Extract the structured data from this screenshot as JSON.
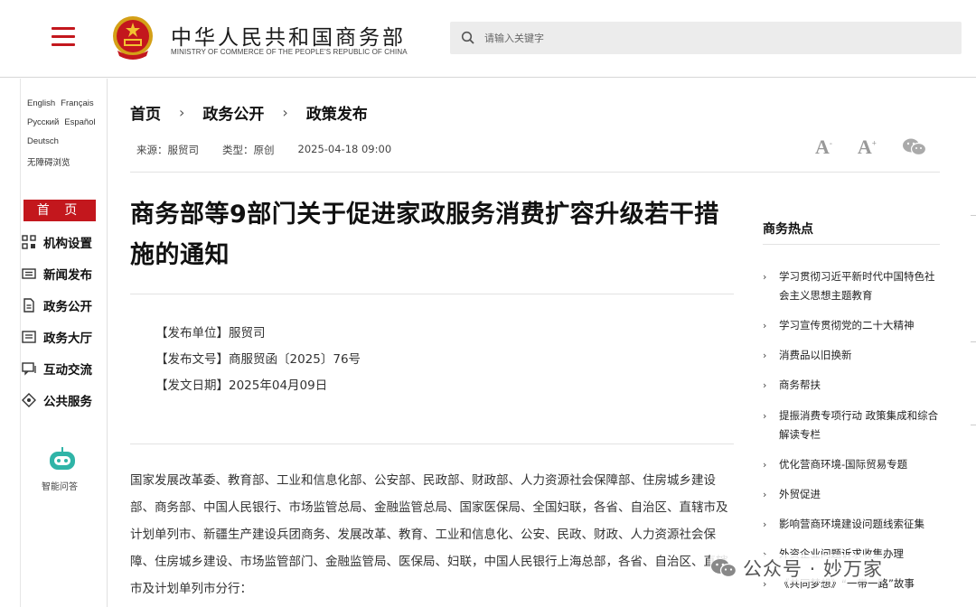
{
  "header": {
    "title": "中华人民共和国商务部",
    "subtitle": "MINISTRY OF COMMERCE OF THE PEOPLE'S REPUBLIC OF CHINA",
    "search_placeholder": "请输入关键字"
  },
  "sidebar": {
    "languages": [
      [
        "English",
        "Français"
      ],
      [
        "Русский",
        "Español"
      ],
      [
        "Deutsch"
      ],
      [
        "无障碍浏览"
      ]
    ],
    "home_label": "首 页",
    "nav_items": [
      {
        "label": "机构设置",
        "icon": "grid-icon"
      },
      {
        "label": "新闻发布",
        "icon": "news-icon"
      },
      {
        "label": "政务公开",
        "icon": "document-icon"
      },
      {
        "label": "政务大厅",
        "icon": "list-icon"
      },
      {
        "label": "互动交流",
        "icon": "chat-icon"
      },
      {
        "label": "公共服务",
        "icon": "service-icon"
      }
    ],
    "assistant_label": "智能问答"
  },
  "breadcrumb": [
    "首页",
    "政务公开",
    "政策发布"
  ],
  "meta": {
    "source": "来源：服贸司",
    "type": "类型：原创",
    "date": "2025-04-18 09:00"
  },
  "tools": {
    "font_small": "A",
    "font_large": "A"
  },
  "article": {
    "title": "商务部等9部门关于促进家政服务消费扩容升级若干措施的通知",
    "issuer": "【发布单位】服贸司",
    "doc_number": "【发布文号】商服贸函〔2025〕76号",
    "issue_date": "【发文日期】2025年04月09日",
    "body": "国家发展改革委、教育部、工业和信息化部、公安部、民政部、财政部、人力资源社会保障部、住房城乡建设部、商务部、中国人民银行、市场监管总局、金融监管总局、国家医保局、全国妇联，各省、自治区、直辖市及计划单列市、新疆生产建设兵团商务、发展改革、教育、工业和信息化、公安、民政、财政、人力资源社会保障、住房城乡建设、市场监管部门、金融监管局、医保局、妇联，中国人民银行上海总部，各省、自治区、直辖市及计划单列市分行："
  },
  "hot": {
    "title": "商务热点",
    "items": [
      "学习贯彻习近平新时代中国特色社会主义思想主题教育",
      "学习宣传贯彻党的二十大精神",
      "消费品以旧换新",
      "商务帮扶",
      "提振消费专项行动 政策集成和综合解读专栏",
      "优化营商环境-国际贸易专题",
      "外贸促进",
      "影响营商环境建设问题线索征集",
      "外资企业问题诉求收集办理",
      "《共同梦想》“一带一路”故事"
    ]
  },
  "watermark": {
    "text": "公众号 · 妙万家"
  },
  "colors": {
    "brand_red": "#c3171d",
    "search_bg": "#ececec"
  }
}
